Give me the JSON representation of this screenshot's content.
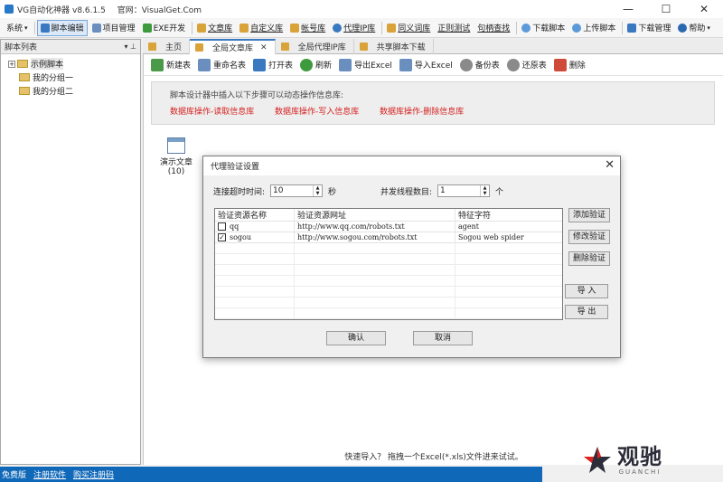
{
  "window": {
    "app_title": "VG自动化神器 v8.6.1.5",
    "site": "官网：VisualGet.Com",
    "minimize": "—",
    "maximize": "☐",
    "close": "✕"
  },
  "toolbar": {
    "items": [
      {
        "label": "系统",
        "caret": "▾"
      },
      {
        "label": "脚本编辑",
        "active": true
      },
      {
        "label": "项目管理"
      },
      {
        "label": "EXE开发"
      },
      {
        "label": "文章库"
      },
      {
        "label": "自定义库"
      },
      {
        "label": "帐号库"
      },
      {
        "label": "代理IP库"
      },
      {
        "label": "同义词库"
      },
      {
        "label": "正则测试"
      },
      {
        "label": "句柄查找"
      },
      {
        "label": "下载脚本"
      },
      {
        "label": "上传脚本"
      },
      {
        "label": "下载管理"
      },
      {
        "label": "帮助",
        "caret": "▾"
      }
    ]
  },
  "left_panel": {
    "title": "脚本列表",
    "tools": "▾ ⊥",
    "tree": {
      "root_expander": "+",
      "root": "示例脚本",
      "children": [
        "我的分组一",
        "我的分组二"
      ]
    }
  },
  "tabs": [
    {
      "label": "主页"
    },
    {
      "label": "全局文章库",
      "active": true,
      "close": "✕"
    },
    {
      "label": "全局代理IP库"
    },
    {
      "label": "共享脚本下载"
    }
  ],
  "actions": [
    "新建表",
    "重命名表",
    "打开表",
    "刷新",
    "导出Excel",
    "导入Excel",
    "备份表",
    "还原表",
    "删除"
  ],
  "info": {
    "title": "脚本设计器中插入以下步骤可以动态操作信息库:",
    "links": [
      "数据库操作-读取信息库",
      "数据库操作-写入信息库",
      "数据库操作-删除信息库"
    ]
  },
  "doc": {
    "name": "演示文章",
    "count": "(10)"
  },
  "bottom_hint": "快速导入？ 拖拽一个Excel(*.xls)文件进来试试。",
  "dialog": {
    "title": "代理验证设置",
    "close": "✕",
    "timeout_label": "连接超时时间:",
    "timeout_value": "10",
    "timeout_unit": "秒",
    "threads_label": "并发线程数目:",
    "threads_value": "1",
    "threads_unit": "个",
    "spin_up": "▲",
    "spin_down": "▼",
    "columns": [
      "验证资源名称",
      "验证资源网址",
      "特征字符"
    ],
    "rows": [
      {
        "checked": false,
        "name": "qq",
        "url": "http://www.qq.com/robots.txt",
        "feature": "agent"
      },
      {
        "checked": true,
        "name": "sogou",
        "url": "http://www.sogou.com/robots.txt",
        "feature": "Sogou web spider"
      }
    ],
    "checkmark": "✓",
    "side_buttons": [
      "添加验证",
      "修改验证",
      "删除验证",
      "导 入",
      "导 出"
    ],
    "ok": "确认",
    "cancel": "取消"
  },
  "statusbar": {
    "items": [
      "免费版",
      "注册软件",
      "购买注册码"
    ]
  },
  "watermark": {
    "cn": "观驰",
    "en": "GUANCHI"
  },
  "colors": {
    "accent": "#1068b8",
    "link_red": "#d62020",
    "tab_active_border": "#3a78c0"
  }
}
